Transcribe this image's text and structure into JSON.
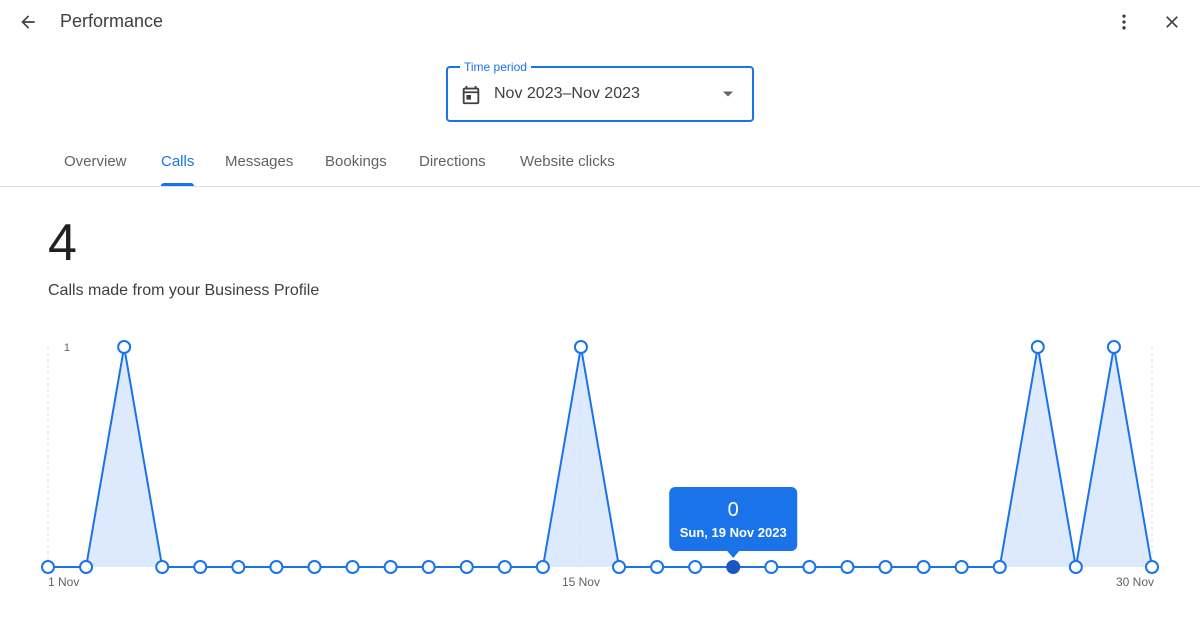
{
  "header": {
    "title": "Performance",
    "back_icon": "arrow-back-icon",
    "more_icon": "more-vert-icon",
    "close_icon": "close-icon"
  },
  "time_period": {
    "label": "Time period",
    "value": "Nov 2023–Nov 2023",
    "icon": "calendar-icon"
  },
  "tabs": [
    {
      "label": "Overview",
      "active": false
    },
    {
      "label": "Calls",
      "active": true
    },
    {
      "label": "Messages",
      "active": false
    },
    {
      "label": "Bookings",
      "active": false
    },
    {
      "label": "Directions",
      "active": false
    },
    {
      "label": "Website clicks",
      "active": false
    }
  ],
  "metric": {
    "value": "4",
    "description": "Calls made from your Business Profile"
  },
  "colors": {
    "accent": "#1a73e8",
    "line": "#1a73e8",
    "area": "#d2e3fc",
    "tooltip": "#1a73e8"
  },
  "chart_data": {
    "type": "area",
    "x": [
      "1 Nov",
      "2 Nov",
      "3 Nov",
      "4 Nov",
      "5 Nov",
      "6 Nov",
      "7 Nov",
      "8 Nov",
      "9 Nov",
      "10 Nov",
      "11 Nov",
      "12 Nov",
      "13 Nov",
      "14 Nov",
      "15 Nov",
      "16 Nov",
      "17 Nov",
      "18 Nov",
      "19 Nov",
      "20 Nov",
      "21 Nov",
      "22 Nov",
      "23 Nov",
      "24 Nov",
      "25 Nov",
      "26 Nov",
      "27 Nov",
      "28 Nov",
      "29 Nov",
      "30 Nov"
    ],
    "values": [
      0,
      0,
      1,
      0,
      0,
      0,
      0,
      0,
      0,
      0,
      0,
      0,
      0,
      0,
      1,
      0,
      0,
      0,
      0,
      0,
      0,
      0,
      0,
      0,
      0,
      0,
      1,
      0,
      1,
      0
    ],
    "x_tick_labels": [
      "1 Nov",
      "15 Nov",
      "30 Nov"
    ],
    "y_tick_labels": [
      "1"
    ],
    "ylim": [
      0,
      1
    ],
    "highlighted_index": 18,
    "tooltip": {
      "value": "0",
      "date": "Sun, 19 Nov 2023"
    }
  }
}
